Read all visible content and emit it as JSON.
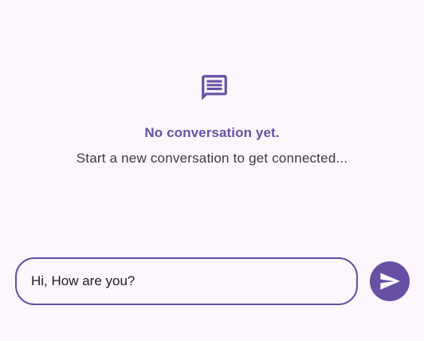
{
  "empty_state": {
    "icon": "chat-bubble-icon",
    "title": "No conversation yet.",
    "subtitle": "Start a new conversation to get connected..."
  },
  "composer": {
    "input_value": "Hi, How are you?",
    "send_icon": "send-icon"
  },
  "colors": {
    "background": "#fdf7fd",
    "accent": "#6750a4",
    "text": "#3a3a3e"
  }
}
